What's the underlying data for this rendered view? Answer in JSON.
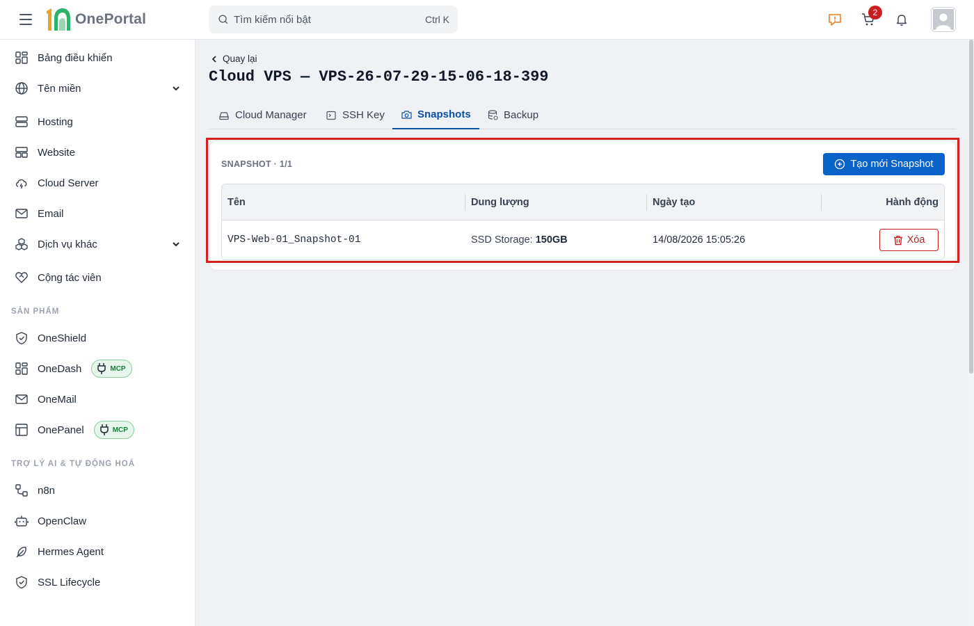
{
  "header": {
    "logo_text": "OnePortal",
    "search_placeholder": "Tìm kiếm nổi bật",
    "search_shortcut": "Ctrl K",
    "cart_badge": "2"
  },
  "sidebar": {
    "items": [
      {
        "label": "Bảng điều khiển"
      },
      {
        "label": "Tên miền"
      },
      {
        "label": "Hosting"
      },
      {
        "label": "Website"
      },
      {
        "label": "Cloud Server"
      },
      {
        "label": "Email"
      },
      {
        "label": "Dịch vụ khác"
      },
      {
        "label": "Cộng tác viên"
      }
    ],
    "products_title": "SẢN PHẨM",
    "products": [
      {
        "label": "OneShield"
      },
      {
        "label": "OneDash",
        "badge": "MCP"
      },
      {
        "label": "OneMail"
      },
      {
        "label": "OnePanel",
        "badge": "MCP"
      }
    ],
    "ai_title": "TRỢ LÝ AI & TỰ ĐỘNG HOÁ",
    "ai_items": [
      {
        "label": "n8n"
      },
      {
        "label": "OpenClaw"
      },
      {
        "label": "Hermes Agent"
      },
      {
        "label": "SSL Lifecycle"
      }
    ]
  },
  "main": {
    "back_label": "Quay lại",
    "title": "Cloud VPS — VPS-26-07-29-15-06-18-399",
    "tabs": [
      {
        "label": "Cloud Manager"
      },
      {
        "label": "SSH Key"
      },
      {
        "label": "Snapshots"
      },
      {
        "label": "Backup"
      }
    ],
    "active_tab": "Snapshots",
    "card": {
      "title": "SNAPSHOT · 1/1",
      "create_button": "Tạo mới Snapshot",
      "columns": [
        "Tên",
        "Dung lượng",
        "Ngày tạo",
        "Hành động"
      ],
      "rows": [
        {
          "name": "VPS-Web-01_Snapshot-01",
          "storage_label": "SSD Storage:",
          "storage_value": "150GB",
          "created": "14/08/2026 15:05:26",
          "action": "Xóa"
        }
      ]
    }
  },
  "colors": {
    "primary": "#0a63c9",
    "danger": "#c81e1e",
    "active_tab": "#0b4fa8",
    "highlight_frame": "#d32020",
    "mcp_green": "#15803d"
  }
}
